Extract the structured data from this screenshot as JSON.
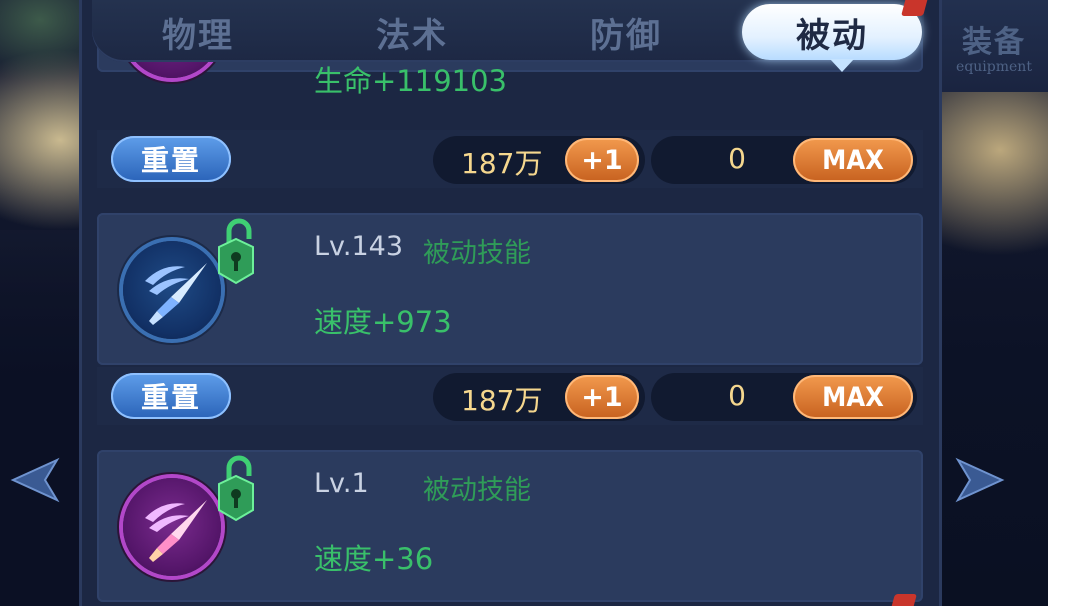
{
  "tabs": [
    {
      "label": "物理",
      "active": false
    },
    {
      "label": "法术",
      "active": false
    },
    {
      "label": "防御",
      "active": false
    },
    {
      "label": "被动",
      "active": true
    }
  ],
  "equipment_tab": {
    "label": "装备",
    "sublabel": "equipment"
  },
  "top_card": {
    "stat": "生命+119103"
  },
  "action_bars": [
    {
      "reset_label": "重置",
      "cost": "187万",
      "plus_label": "+1",
      "count": "0",
      "max_label": "MAX"
    },
    {
      "reset_label": "重置",
      "cost": "187万",
      "plus_label": "+1",
      "count": "0",
      "max_label": "MAX"
    }
  ],
  "skills": [
    {
      "level": "Lv.143",
      "type": "被动技能",
      "stat": "速度+973",
      "icon": "blue-dagger-icon",
      "lock": "unlocked-padlock-icon"
    },
    {
      "level": "Lv.1",
      "type": "被动技能",
      "stat": "速度+36",
      "icon": "purple-dagger-icon",
      "lock": "unlocked-padlock-icon"
    }
  ],
  "colors": {
    "panel": "#1c2743",
    "card": "#2b3b5e",
    "stat_green": "#39c06a",
    "type_green": "#2f9c58",
    "cost_gold": "#f5d78e",
    "reset_blue": "#3f80d6",
    "action_orange": "#e07a33",
    "active_tab": "#e3f1ff"
  }
}
